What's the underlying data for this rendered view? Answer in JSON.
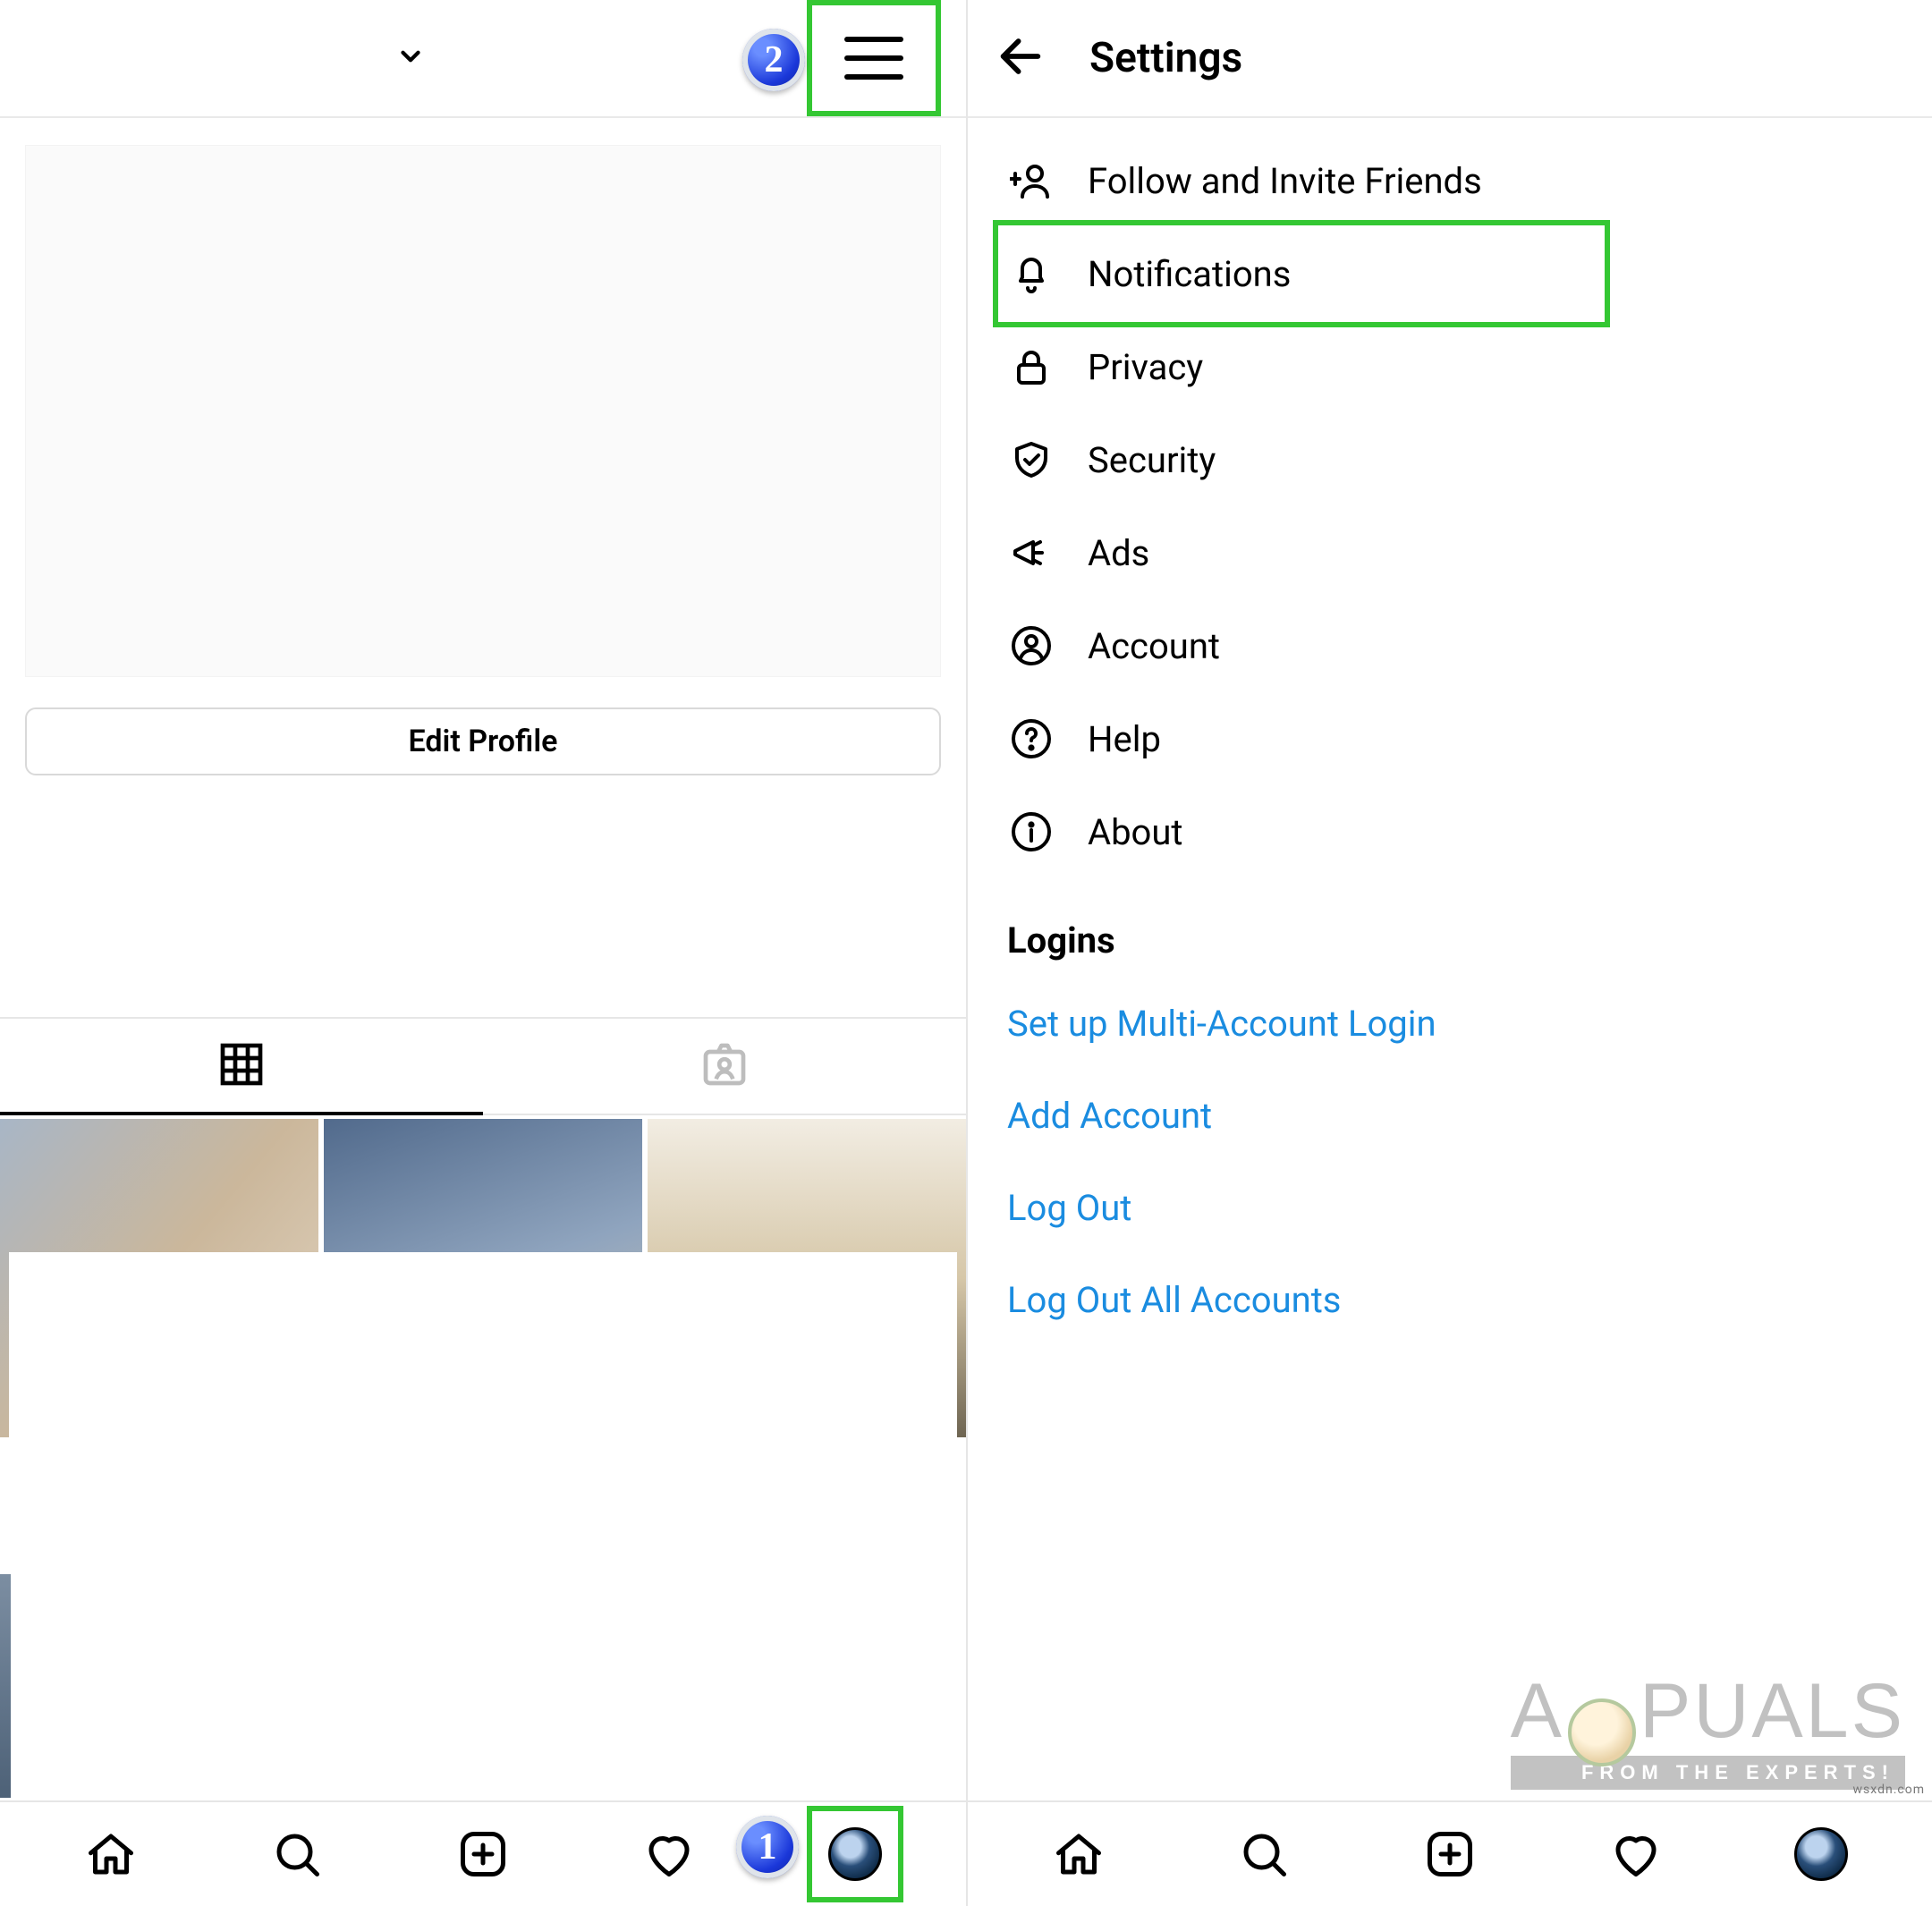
{
  "left": {
    "edit_profile_label": "Edit Profile"
  },
  "right": {
    "title": "Settings",
    "items": [
      {
        "label": "Follow and Invite Friends"
      },
      {
        "label": "Notifications"
      },
      {
        "label": "Privacy"
      },
      {
        "label": "Security"
      },
      {
        "label": "Ads"
      },
      {
        "label": "Account"
      },
      {
        "label": "Help"
      },
      {
        "label": "About"
      }
    ],
    "section_header": "Logins",
    "login_links": [
      "Set up Multi-Account Login",
      "Add Account",
      "Log Out",
      "Log Out All Accounts"
    ]
  },
  "annotations": {
    "step1": "1",
    "step2": "2"
  },
  "watermark": {
    "brand_prefix": "A",
    "brand_suffix": "PUALS",
    "tagline": "FROM THE EXPERTS!",
    "credit": "wsxdn.com"
  }
}
